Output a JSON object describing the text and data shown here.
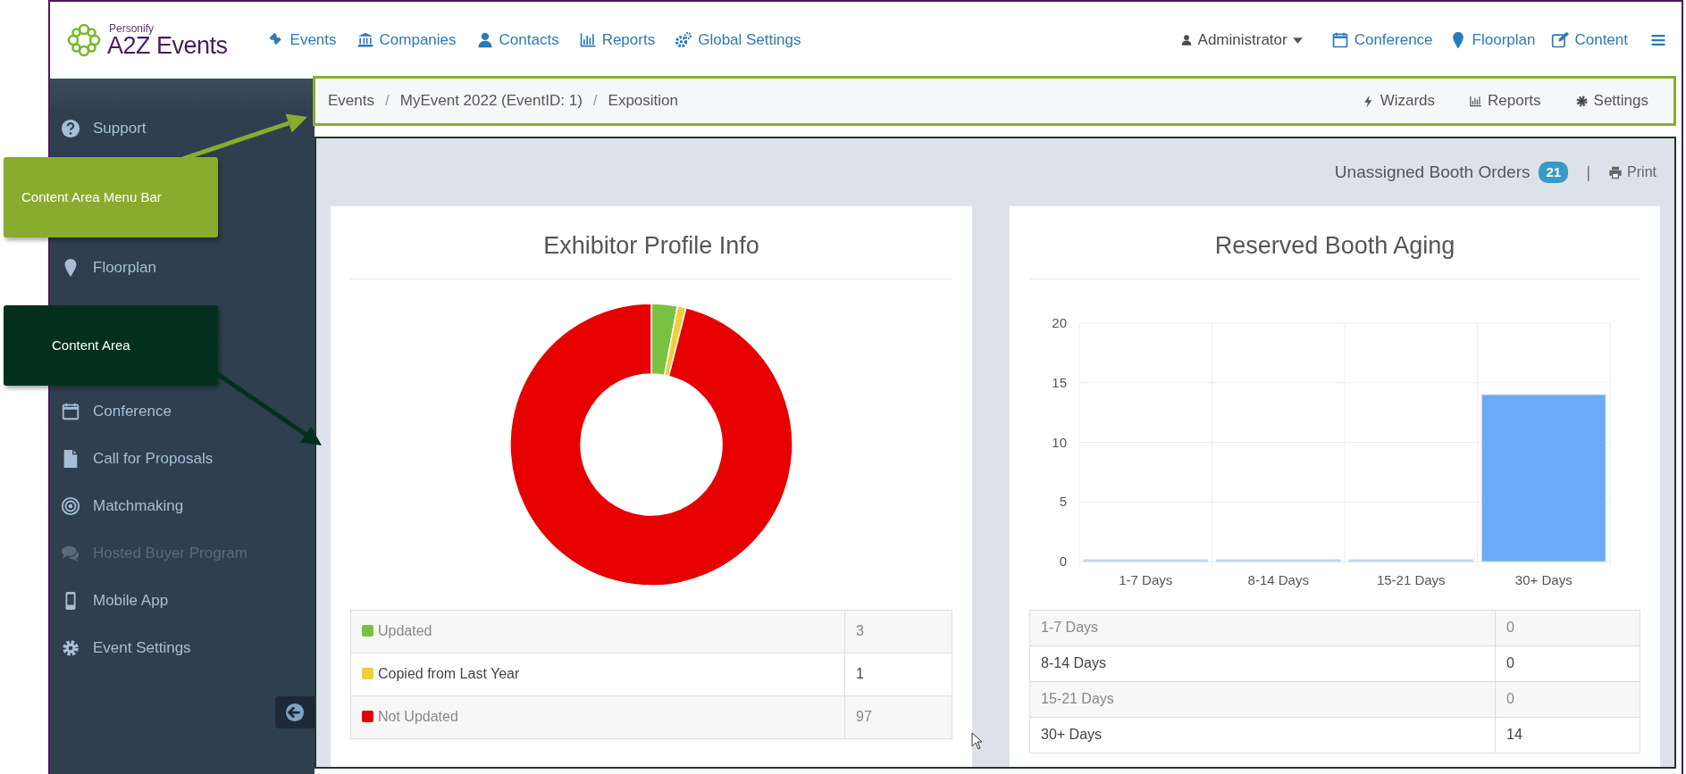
{
  "logo": {
    "tagline": "Personify",
    "name": "A2Z Events"
  },
  "top_nav": [
    {
      "label": "Events"
    },
    {
      "label": "Companies"
    },
    {
      "label": "Contacts"
    },
    {
      "label": "Reports"
    },
    {
      "label": "Global Settings"
    }
  ],
  "user_menu": {
    "label": "Administrator"
  },
  "right_nav": [
    {
      "label": "Conference"
    },
    {
      "label": "Floorplan"
    },
    {
      "label": "Content"
    }
  ],
  "breadcrumb": [
    {
      "label": "Events"
    },
    {
      "separator": "/",
      "label": "MyEvent 2022 (EventID: 1)"
    },
    {
      "separator": "/",
      "label": "Exposition"
    }
  ],
  "breadcrumb_actions": [
    {
      "label": "Wizards"
    },
    {
      "label": "Reports"
    },
    {
      "label": "Settings"
    }
  ],
  "sidebar": {
    "entries": [
      {
        "kind": "link",
        "label": "Support",
        "disabled": false
      },
      {
        "kind": "callout",
        "text": "Content Area Menu Bar",
        "color": "#8aac2e"
      },
      {
        "kind": "link",
        "label": "Floorplan",
        "disabled": false
      },
      {
        "kind": "callout",
        "text": "Content Area",
        "color": "#03301d"
      },
      {
        "kind": "link",
        "label": "Conference",
        "disabled": false
      },
      {
        "kind": "link",
        "label": "Call for Proposals",
        "disabled": false
      },
      {
        "kind": "link",
        "label": "Matchmaking",
        "disabled": false
      },
      {
        "kind": "link",
        "label": "Hosted Buyer Program",
        "disabled": true
      },
      {
        "kind": "link",
        "label": "Mobile App",
        "disabled": false
      },
      {
        "kind": "link",
        "label": "Event Settings",
        "disabled": false
      }
    ]
  },
  "content_header": {
    "label": "Unassigned Booth Orders",
    "count": "21",
    "separator": "|",
    "print": "Print"
  },
  "cards": [
    {
      "title": "Exhibitor Profile Info",
      "chart_data": {
        "type": "donut",
        "categories": [
          "Updated",
          "Copied from Last Year",
          "Not Updated"
        ],
        "values": [
          3,
          1,
          97
        ]
      },
      "rows": [
        {
          "value": "3",
          "color": "#7ac142"
        },
        {
          "value": "1",
          "color": "#f5cc3a"
        },
        {
          "value": "97",
          "color": "#e60000"
        }
      ]
    },
    {
      "title": "Reserved Booth Aging",
      "chart_data": {
        "type": "bar",
        "categories": [
          "1-7 Days",
          "8-14 Days",
          "15-21 Days",
          "30+ Days"
        ],
        "series": [
          {
            "color": "#6aabf7",
            "values": [
              0,
              0,
              0,
              14
            ]
          }
        ],
        "ylim": [
          0,
          20
        ],
        "yticks": [
          0,
          5,
          10,
          15,
          20
        ],
        "grid": true
      },
      "rows": [
        {
          "label": "1-7 Days",
          "value": "0"
        },
        {
          "label": "8-14 Days",
          "value": "0"
        },
        {
          "label": "15-21 Days",
          "value": "0"
        },
        {
          "label": "30+ Days",
          "value": "14"
        }
      ]
    }
  ]
}
